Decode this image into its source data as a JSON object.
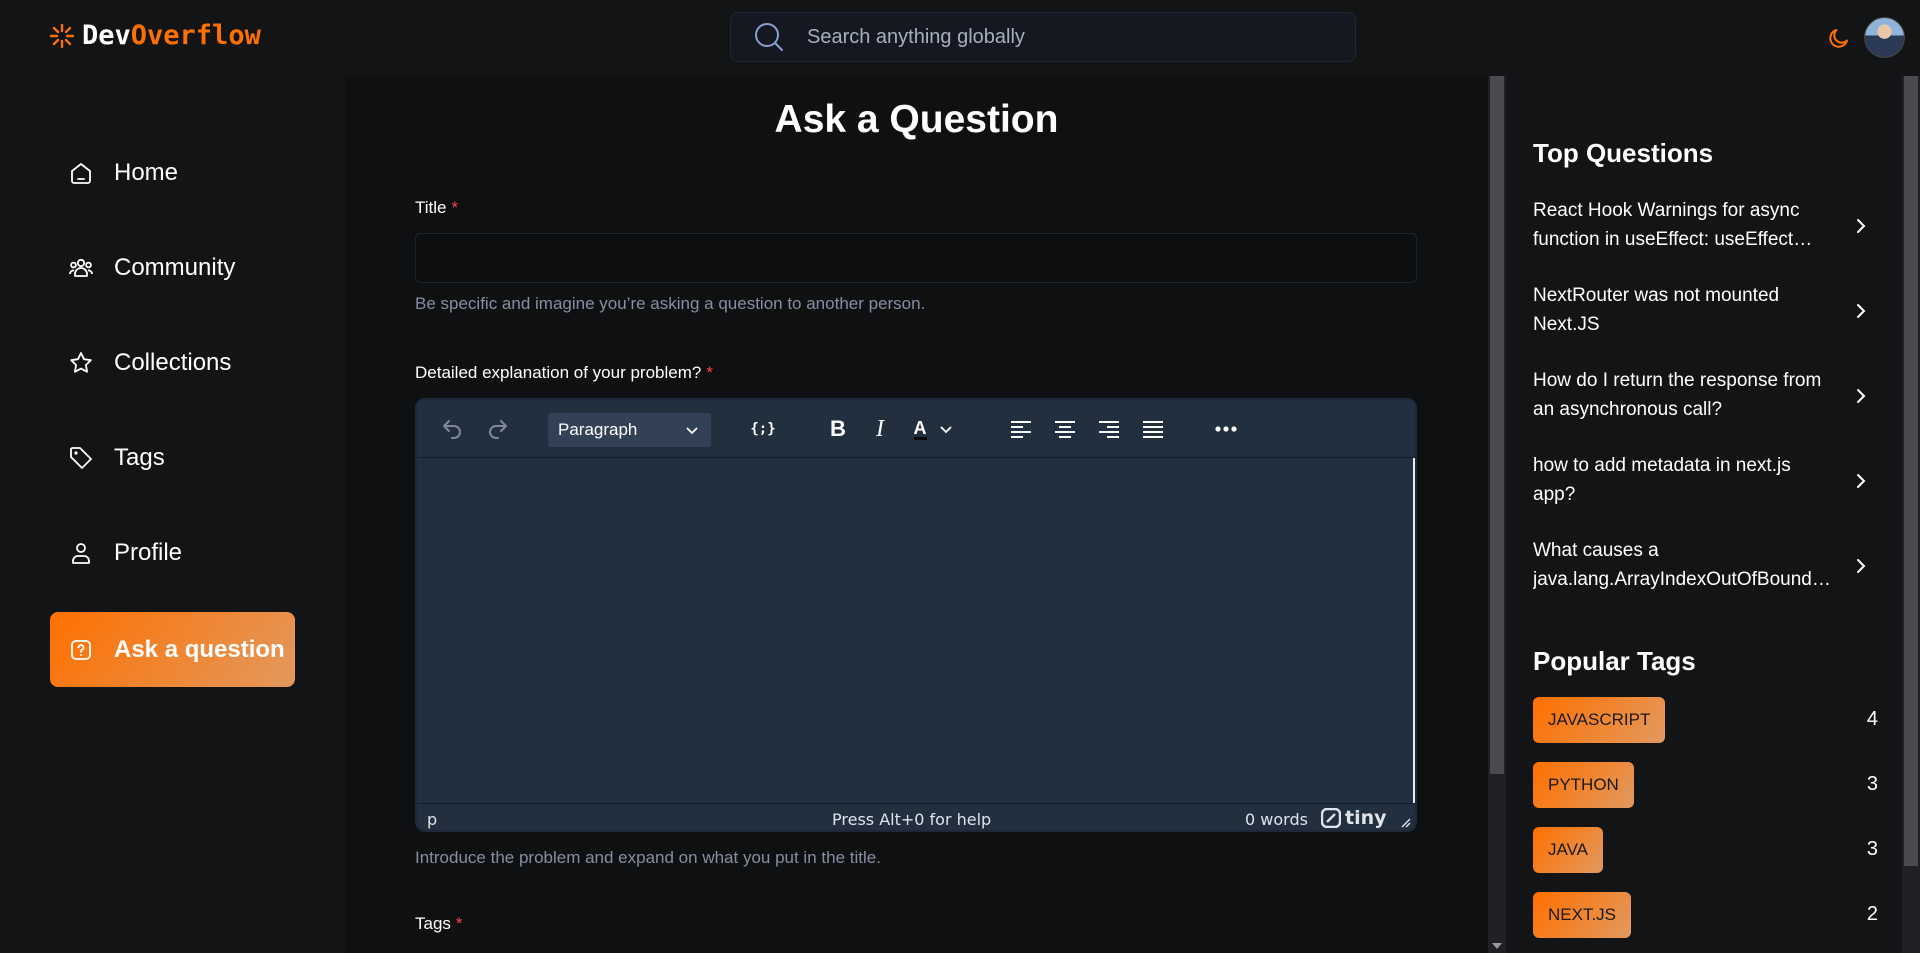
{
  "logo": {
    "dev": "Dev",
    "overflow": "Overflow"
  },
  "search": {
    "placeholder": "Search anything globally"
  },
  "sidebar": {
    "items": [
      {
        "label": "Home",
        "icon": "home-icon"
      },
      {
        "label": "Community",
        "icon": "users-icon"
      },
      {
        "label": "Collections",
        "icon": "star-icon"
      },
      {
        "label": "Tags",
        "icon": "tag-icon"
      },
      {
        "label": "Profile",
        "icon": "user-icon"
      },
      {
        "label": "Ask a question",
        "icon": "question-icon",
        "active": true
      }
    ]
  },
  "main": {
    "title": "Ask a Question",
    "title_label": "Title",
    "required_mark": "*",
    "title_hint": "Be specific and imagine you’re asking a question to another person.",
    "explanation_label": "Detailed explanation of your problem?",
    "explanation_hint": "Introduce the problem and expand on what you put in the title.",
    "tags_label": "Tags"
  },
  "editor": {
    "block_format": "Paragraph",
    "status_path": "p",
    "status_help": "Press Alt+0 for help",
    "word_count": "0 words",
    "brand": "tiny"
  },
  "right": {
    "top_questions_title": "Top Questions",
    "top_questions": [
      "React Hook Warnings for async function in useEffect: useEffect function must return a cleanup function or nothing",
      "NextRouter was not mounted Next.JS",
      "How do I return the response from an asynchronous call?",
      "how to add metadata in next.js app?",
      "What causes a java.lang.ArrayIndexOutOfBoundsException and how do I prevent it?"
    ],
    "popular_tags_title": "Popular Tags",
    "popular_tags": [
      {
        "name": "JAVASCRIPT",
        "count": "4"
      },
      {
        "name": "PYTHON",
        "count": "3"
      },
      {
        "name": "JAVA",
        "count": "3"
      },
      {
        "name": "NEXT.JS",
        "count": "2"
      }
    ]
  },
  "colors": {
    "accent": "#ff7000",
    "accent_light": "#e2995f",
    "background": "#0f1012",
    "panel": "#131416",
    "editor": "#222f3e"
  }
}
